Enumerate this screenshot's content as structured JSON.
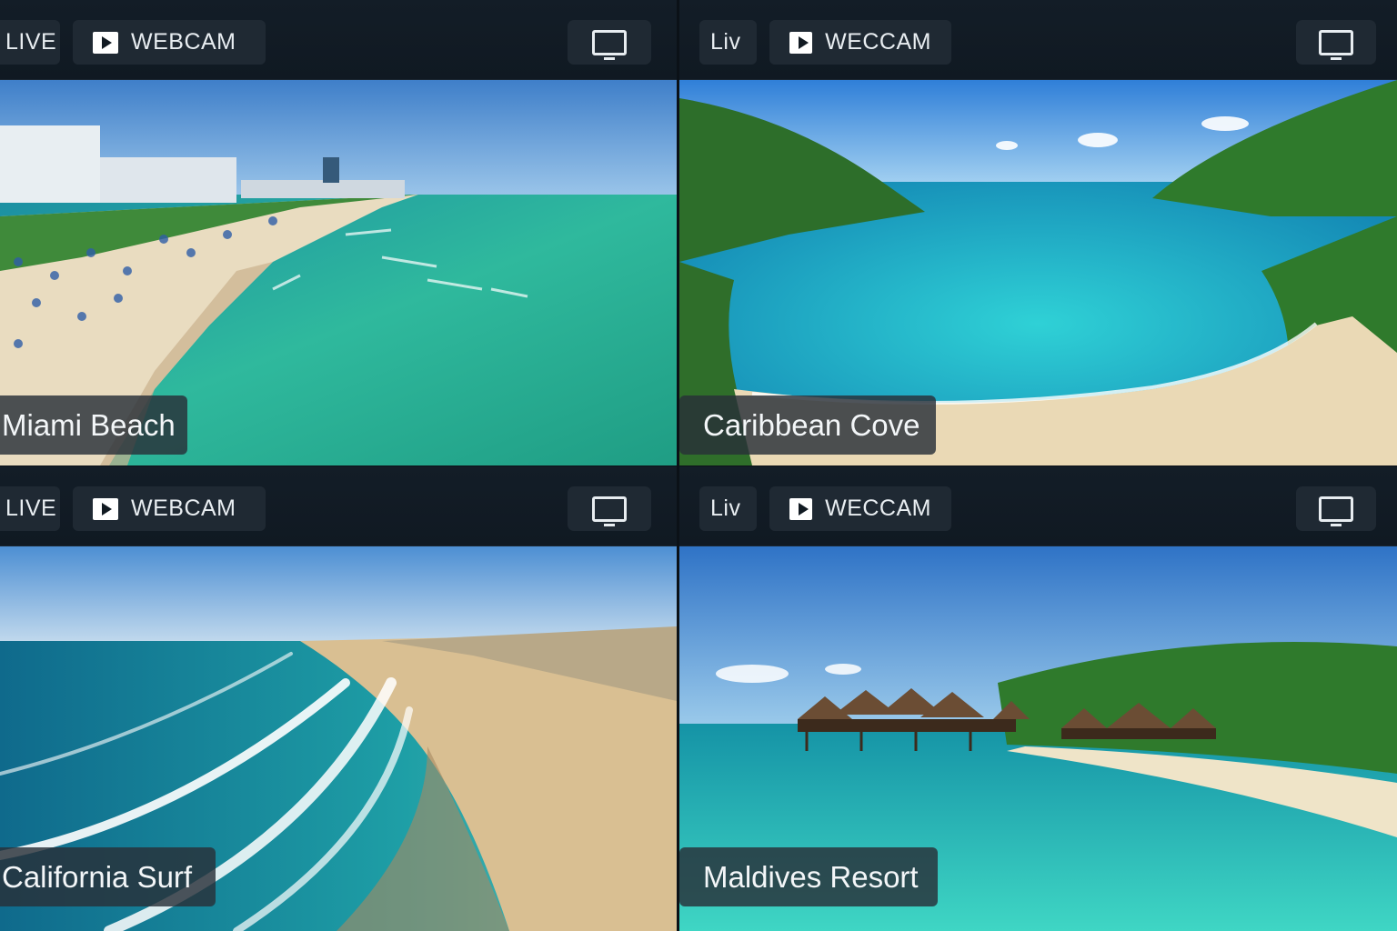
{
  "cameras": [
    {
      "live_label": "LIVE",
      "webcam_label": "WEBCAM",
      "location": "Miami Beach",
      "icons": {
        "play": "play-icon",
        "screen": "monitor-icon"
      }
    },
    {
      "live_label": "Liv",
      "webcam_label": "WECCAM",
      "location": "Caribbean Cove",
      "icons": {
        "play": "play-icon",
        "screen": "monitor-icon"
      }
    },
    {
      "live_label": "LIVE",
      "webcam_label": "WEBCAM",
      "location": "California Surf",
      "icons": {
        "play": "play-icon",
        "screen": "monitor-icon"
      }
    },
    {
      "live_label": "Liv",
      "webcam_label": "WECCAM",
      "location": "Maldives Resort",
      "icons": {
        "play": "play-icon",
        "screen": "monitor-icon"
      }
    }
  ],
  "colors": {
    "background": "#0b1117",
    "chip": "#1f2933",
    "label_bg": "#283038",
    "text": "#e8edf1"
  }
}
